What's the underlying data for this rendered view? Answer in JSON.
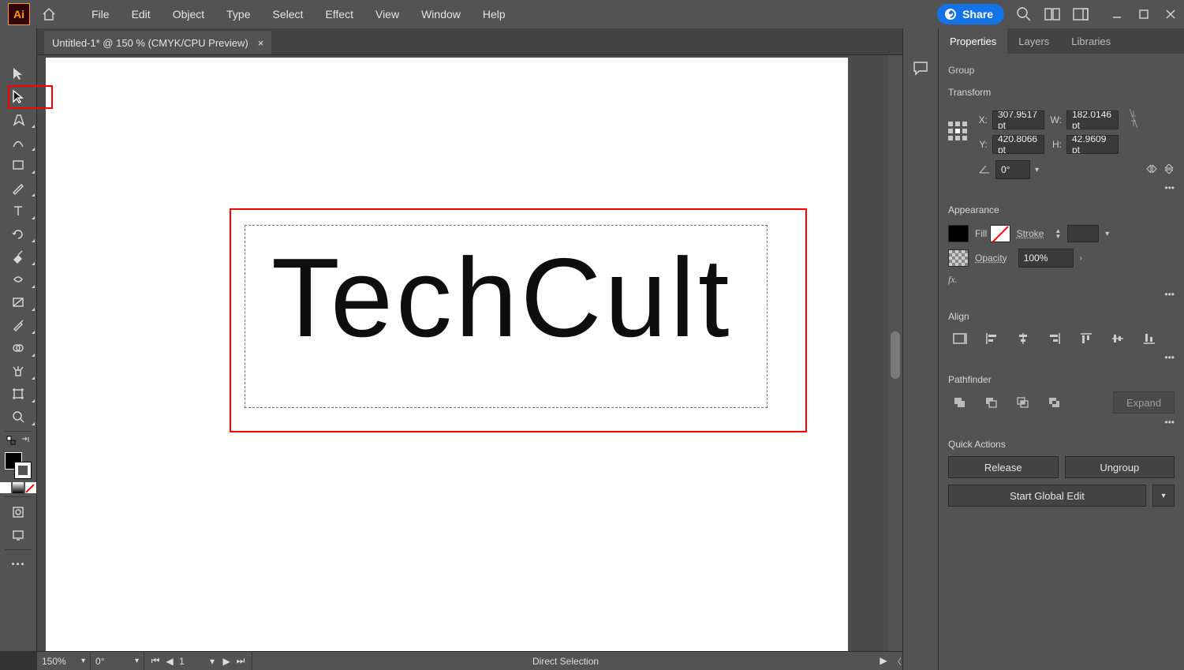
{
  "menu": {
    "items": [
      "File",
      "Edit",
      "Object",
      "Type",
      "Select",
      "Effect",
      "View",
      "Window",
      "Help"
    ],
    "share": "Share"
  },
  "doc_tab": {
    "title": "Untitled-1* @ 150 % (CMYK/CPU Preview)",
    "close": "×"
  },
  "canvas": {
    "text": "TechCult"
  },
  "zoom_combo": "150%",
  "rotate_combo": "0°",
  "artboard_nav": {
    "page": "1"
  },
  "status_tool": "Direct Selection",
  "panels": {
    "tabs": [
      "Properties",
      "Layers",
      "Libraries"
    ],
    "active_tab": 0,
    "selection_type": "Group",
    "sections": {
      "transform": {
        "title": "Transform",
        "x_label": "X:",
        "x": "307.9517 pt",
        "y_label": "Y:",
        "y": "420.8066 pt",
        "w_label": "W:",
        "w": "182.0146 pt",
        "h_label": "H:",
        "h": "42.9609 pt",
        "angle": "0°"
      },
      "appearance": {
        "title": "Appearance",
        "fill_label": "Fill",
        "stroke_label": "Stroke",
        "opacity_label": "Opacity",
        "opacity_value": "100%",
        "fx": "fx."
      },
      "align": {
        "title": "Align"
      },
      "pathfinder": {
        "title": "Pathfinder",
        "expand": "Expand"
      },
      "quick": {
        "title": "Quick Actions",
        "release": "Release",
        "ungroup": "Ungroup",
        "global_edit": "Start Global Edit"
      }
    }
  }
}
